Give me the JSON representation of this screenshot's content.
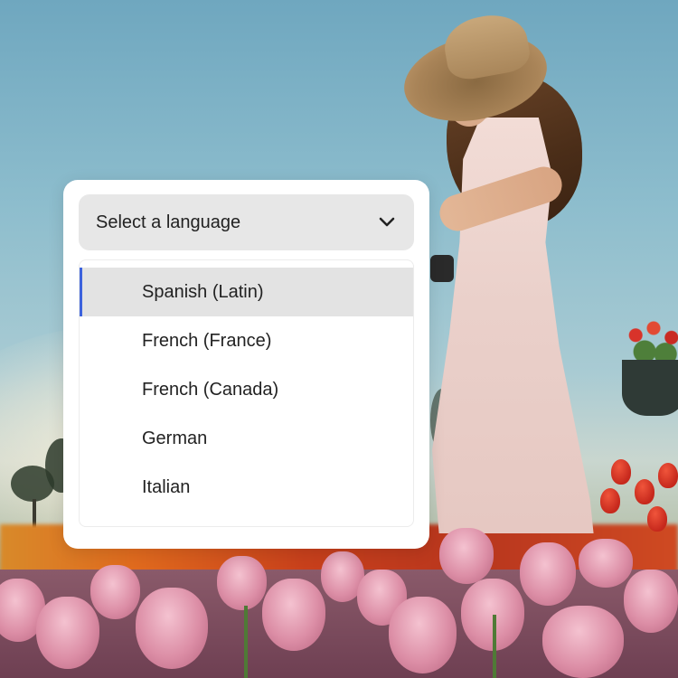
{
  "language_picker": {
    "label": "Select a language",
    "expand_icon": "chevron-down-icon",
    "options": [
      {
        "label": "Spanish (Latin)",
        "selected": true
      },
      {
        "label": "French (France)",
        "selected": false
      },
      {
        "label": "French (Canada)",
        "selected": false
      },
      {
        "label": "German",
        "selected": false
      },
      {
        "label": "Italian",
        "selected": false
      }
    ],
    "colors": {
      "selection_indicator": "#3d63dd",
      "selected_row_bg": "#e3e3e3",
      "picker_bg": "#e7e7e7",
      "panel_bg": "#ffffff"
    }
  }
}
